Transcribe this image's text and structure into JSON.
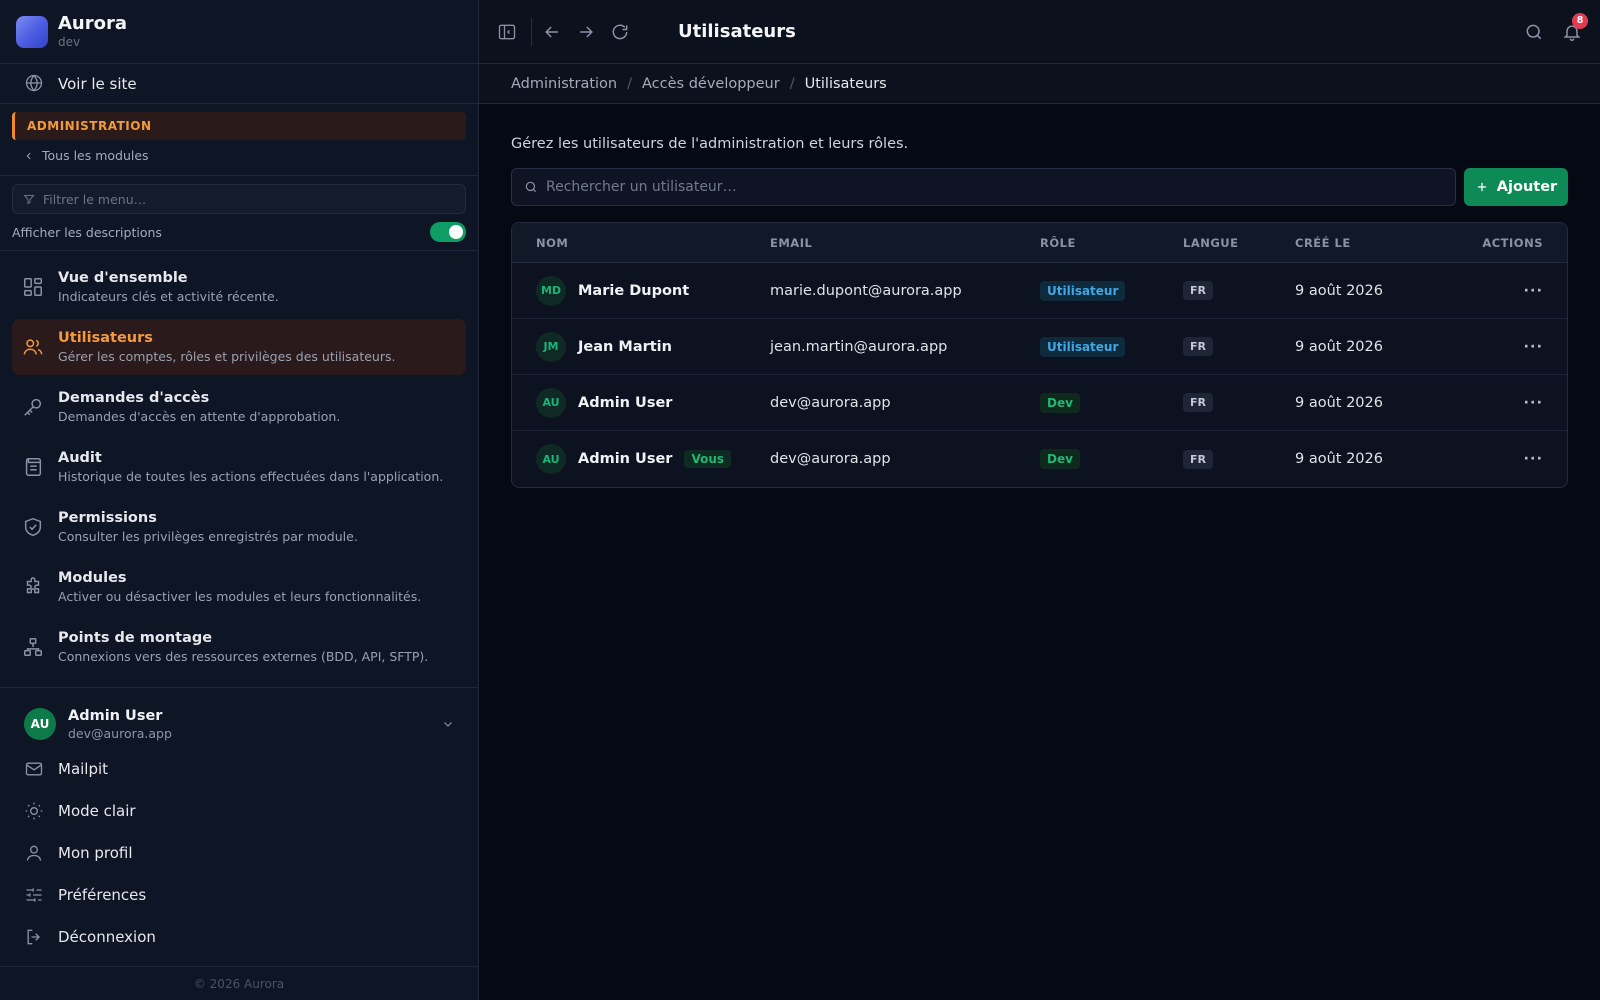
{
  "brand": {
    "name": "Aurora",
    "env": "dev"
  },
  "sidebar": {
    "view_site": "Voir le site",
    "section": "ADMINISTRATION",
    "back": "Tous les modules",
    "filter_placeholder": "Filtrer le menu…",
    "show_descriptions": "Afficher les descriptions",
    "show_descriptions_on": true,
    "items": [
      {
        "title": "Vue d'ensemble",
        "desc": "Indicateurs clés et activité récente.",
        "icon": "grid-icon"
      },
      {
        "title": "Utilisateurs",
        "desc": "Gérer les comptes, rôles et privilèges des utilisateurs.",
        "icon": "users-icon",
        "active": true
      },
      {
        "title": "Demandes d'accès",
        "desc": "Demandes d'accès en attente d'approbation.",
        "icon": "key-icon"
      },
      {
        "title": "Audit",
        "desc": "Historique de toutes les actions effectuées dans l'application.",
        "icon": "scroll-icon"
      },
      {
        "title": "Permissions",
        "desc": "Consulter les privilèges enregistrés par module.",
        "icon": "shield-icon"
      },
      {
        "title": "Modules",
        "desc": "Activer ou désactiver les modules et leurs fonctionnalités.",
        "icon": "puzzle-icon"
      },
      {
        "title": "Points de montage",
        "desc": "Connexions vers des ressources externes (BDD, API, SFTP).",
        "icon": "network-icon"
      }
    ],
    "user": {
      "initials": "AU",
      "name": "Admin User",
      "email": "dev@aurora.app"
    },
    "bottom": [
      {
        "label": "Mailpit",
        "icon": "mail-icon"
      },
      {
        "label": "Mode clair",
        "icon": "sun-icon"
      },
      {
        "label": "Mon profil",
        "icon": "user-icon"
      },
      {
        "label": "Préférences",
        "icon": "sliders-icon"
      },
      {
        "label": "Déconnexion",
        "icon": "logout-icon"
      }
    ],
    "footer": "© 2026 Aurora"
  },
  "header": {
    "title": "Utilisateurs",
    "notifications": "8"
  },
  "breadcrumb": [
    "Administration",
    "Accès développeur",
    "Utilisateurs"
  ],
  "main": {
    "intro": "Gérez les utilisateurs de l'administration et leurs rôles.",
    "search_placeholder": "Rechercher un utilisateur…",
    "add_label": "Ajouter",
    "columns": [
      "NOM",
      "EMAIL",
      "RÔLE",
      "LANGUE",
      "CRÉÉ LE",
      "ACTIONS"
    ],
    "rows": [
      {
        "initials": "MD",
        "name": "Marie Dupont",
        "you": "",
        "email": "marie.dupont@aurora.app",
        "role": "Utilisateur",
        "role_type": "user",
        "lang": "FR",
        "created": "9 août 2026"
      },
      {
        "initials": "JM",
        "name": "Jean Martin",
        "you": "",
        "email": "jean.martin@aurora.app",
        "role": "Utilisateur",
        "role_type": "user",
        "lang": "FR",
        "created": "9 août 2026"
      },
      {
        "initials": "AU",
        "name": "Admin User",
        "you": "",
        "email": "dev@aurora.app",
        "role": "Dev",
        "role_type": "dev",
        "lang": "FR",
        "created": "9 août 2026"
      },
      {
        "initials": "AU",
        "name": "Admin User",
        "you": "Vous",
        "email": "dev@aurora.app",
        "role": "Dev",
        "role_type": "dev",
        "lang": "FR",
        "created": "9 août 2026"
      }
    ]
  },
  "colors": {
    "accent": "#f39a3f",
    "primary_button": "#0e8a57",
    "role_user": "#3fa7e8",
    "role_dev": "#1fb874",
    "notification": "#e23b54"
  }
}
